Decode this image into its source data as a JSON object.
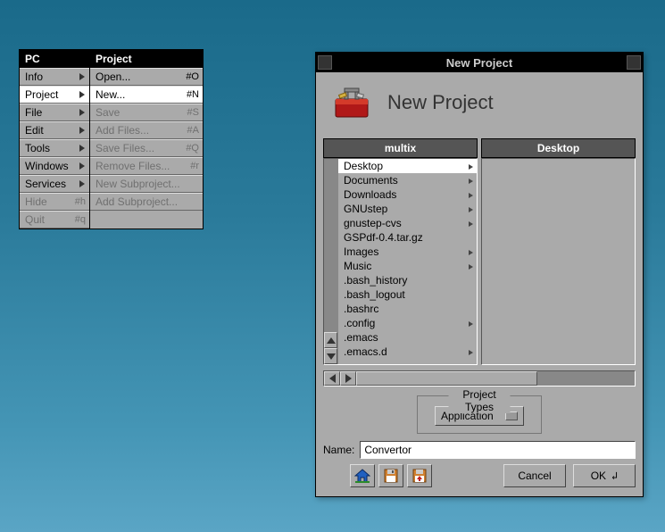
{
  "menu": {
    "columns": [
      {
        "title": "PC",
        "items": [
          {
            "label": "Info",
            "hasSubmenu": true,
            "enabled": true
          },
          {
            "label": "Project",
            "hasSubmenu": true,
            "enabled": true,
            "selected": true
          },
          {
            "label": "File",
            "hasSubmenu": true,
            "enabled": true
          },
          {
            "label": "Edit",
            "hasSubmenu": true,
            "enabled": true
          },
          {
            "label": "Tools",
            "hasSubmenu": true,
            "enabled": true
          },
          {
            "label": "Windows",
            "hasSubmenu": true,
            "enabled": true
          },
          {
            "label": "Services",
            "hasSubmenu": true,
            "enabled": true
          },
          {
            "label": "Hide",
            "shortcut": "#h",
            "enabled": false
          },
          {
            "label": "Quit",
            "shortcut": "#q",
            "enabled": false
          }
        ]
      },
      {
        "title": "Project",
        "items": [
          {
            "label": "Open...",
            "shortcut": "#O",
            "enabled": true
          },
          {
            "label": "New...",
            "shortcut": "#N",
            "enabled": true,
            "selected": true
          },
          {
            "label": "Save",
            "shortcut": "#S",
            "enabled": false
          },
          {
            "label": "Add Files...",
            "shortcut": "#A",
            "enabled": false
          },
          {
            "label": "Save Files...",
            "shortcut": "#Q",
            "enabled": false
          },
          {
            "label": "Remove Files...",
            "shortcut": "#r",
            "enabled": false
          },
          {
            "label": "New Subproject...",
            "enabled": false
          },
          {
            "label": "Add Subproject...",
            "enabled": false
          }
        ]
      }
    ]
  },
  "dialog": {
    "title": "New Project",
    "header": "New Project",
    "browser_columns": [
      {
        "title": "multix",
        "items": [
          {
            "label": "Desktop",
            "branch": true,
            "selected": true
          },
          {
            "label": "Documents",
            "branch": true
          },
          {
            "label": "Downloads",
            "branch": true
          },
          {
            "label": "GNUstep",
            "branch": true
          },
          {
            "label": "gnustep-cvs",
            "branch": true
          },
          {
            "label": "GSPdf-0.4.tar.gz"
          },
          {
            "label": "Images",
            "branch": true
          },
          {
            "label": "Music",
            "branch": true
          },
          {
            "label": ".bash_history"
          },
          {
            "label": ".bash_logout"
          },
          {
            "label": ".bashrc"
          },
          {
            "label": ".config",
            "branch": true
          },
          {
            "label": ".emacs"
          },
          {
            "label": ".emacs.d",
            "branch": true
          }
        ]
      },
      {
        "title": "Desktop",
        "items": []
      }
    ],
    "project_types_legend": "Project Types",
    "project_type_value": "Application",
    "name_label": "Name:",
    "name_value": "Convertor",
    "buttons": {
      "cancel": "Cancel",
      "ok": "OK"
    }
  }
}
